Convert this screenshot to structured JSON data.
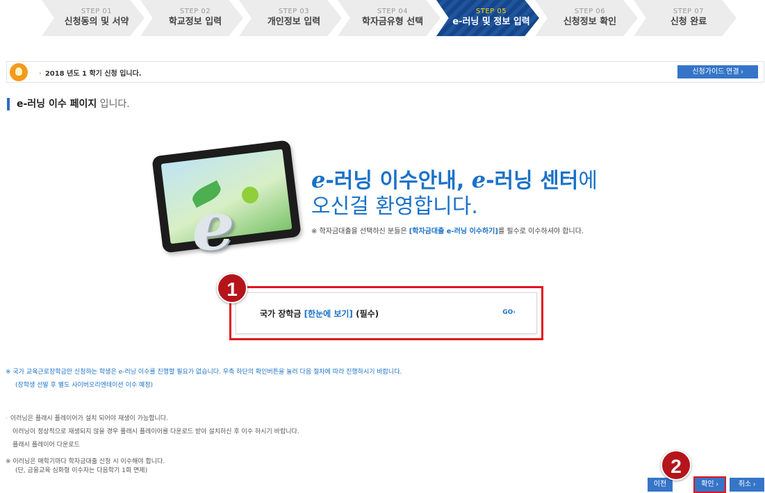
{
  "steps": [
    {
      "num": "STEP 01",
      "label": "신청동의 및 서약"
    },
    {
      "num": "STEP 02",
      "label": "학교정보 입력"
    },
    {
      "num": "STEP 03",
      "label": "개인정보 입력"
    },
    {
      "num": "STEP 04",
      "label": "학자금유형 선택"
    },
    {
      "num": "STEP 05",
      "label": "e-러닝 및 정보 입력"
    },
    {
      "num": "STEP 06",
      "label": "신청정보 확인"
    },
    {
      "num": "STEP 07",
      "label": "신청 완료"
    }
  ],
  "active_step": 5,
  "notice": {
    "text": "2018 년도 1 학기 신청 입니다.",
    "guide_button": "신청가이드 연결 ›"
  },
  "page_title": {
    "strong": "e-러닝 이수 페이지",
    "light": "입니다."
  },
  "hero": {
    "e1": "e",
    "t1": "-러닝 이수안내, ",
    "e2": "e",
    "t2": "-러닝 센터",
    "t3": "에",
    "line2": "오신걸 환영합니다.",
    "note_prefix": "※ 학자금대출을 선택하신 분들은 ",
    "note_link": "[학자금대출 e-러닝 이수하기]",
    "note_suffix": "를 필수로 이수하셔야 합니다."
  },
  "course": {
    "prefix": "국가 장학금 ",
    "highlight": "[한눈에 보기]",
    "suffix": " (필수)",
    "go": "GO›"
  },
  "markers": {
    "one": "1",
    "two": "2"
  },
  "info": {
    "scholarship_line1": "※ 국가 교육근로장학금만 신청하는 학생은 e-러닝 이수를 진행할 필요가 없습니다. 우측 하단의 확인버튼을 눌러 다음 절차에 따라 진행하시기 바랍니다.",
    "scholarship_line2": "(장학생 선발 후 별도 사이버오리엔테이션 이수 예정)",
    "flash_line1": "이러닝은 플래시 플레이어가 설치 되어야 재생이 가능합니다.",
    "flash_line2": "이러닝이 정상적으로 재생되지 않을 경우 플래시 플레이어를 다운로드 받아 설치하신 후 이수 하시기 바랍니다.",
    "flash_line3": "플래시 플레이어 다운로드",
    "edu_line1": "※ 이러닝은 매학기마다 학자금대출 신청 시 이수해야 합니다.",
    "edu_line2": "(단, 금융교육 심화형 이수자는 다음학기 1회 면제)"
  },
  "buttons": {
    "prev": "이전",
    "confirm": "확인 ›",
    "cancel": "취소 ›"
  },
  "colors": {
    "accent_blue": "#1a72c9",
    "button_blue": "#3575c8",
    "highlight_red": "#e2141c",
    "marker_red": "#b5141b",
    "bulb_orange": "#f39a1b"
  }
}
